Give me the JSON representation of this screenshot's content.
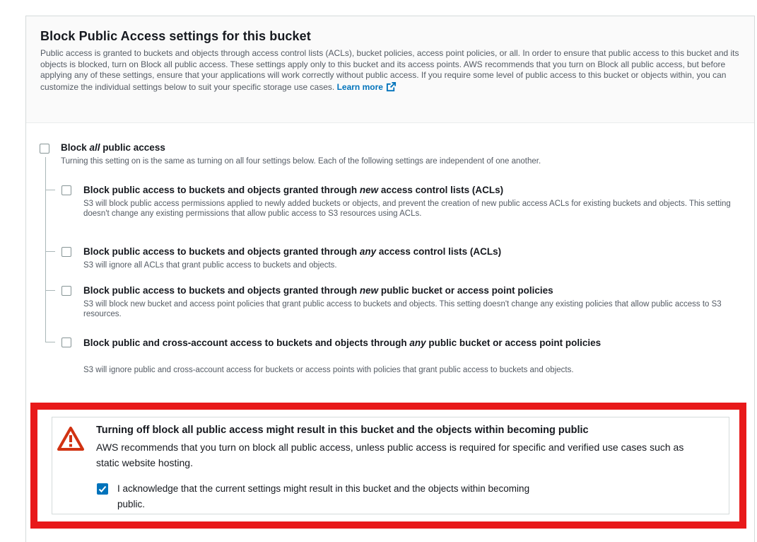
{
  "header": {
    "title": "Block Public Access settings for this bucket",
    "description": "Public access is granted to buckets and objects through access control lists (ACLs), bucket policies, access point policies, or all. In order to ensure that public access to this bucket and its objects is blocked, turn on Block all public access. These settings apply only to this bucket and its access points. AWS recommends that you turn on Block all public access, but before applying any of these settings, ensure that your applications will work correctly without public access. If you require some level of public access to this bucket or objects within, you can customize the individual settings below to suit your specific storage use cases.",
    "learn_more": "Learn more"
  },
  "block_all": {
    "title_prefix": "Block ",
    "title_em": "all",
    "title_suffix": " public access",
    "description": "Turning this setting on is the same as turning on all four settings below. Each of the following settings are independent of one another.",
    "checked": false
  },
  "settings": [
    {
      "title_prefix": "Block public access to buckets and objects granted through ",
      "title_em": "new",
      "title_suffix": " access control lists (ACLs)",
      "description": "S3 will block public access permissions applied to newly added buckets or objects, and prevent the creation of new public access ACLs for existing buckets and objects. This setting doesn't change any existing permissions that allow public access to S3 resources using ACLs.",
      "checked": false
    },
    {
      "title_prefix": "Block public access to buckets and objects granted through ",
      "title_em": "any",
      "title_suffix": " access control lists (ACLs)",
      "description": "S3 will ignore all ACLs that grant public access to buckets and objects.",
      "checked": false
    },
    {
      "title_prefix": "Block public access to buckets and objects granted through ",
      "title_em": "new",
      "title_suffix": " public bucket or access point policies",
      "description": "S3 will block new bucket and access point policies that grant public access to buckets and objects. This setting doesn't change any existing policies that allow public access to S3 resources.",
      "checked": false
    },
    {
      "title_prefix": "Block public and cross-account access to buckets and objects through ",
      "title_em": "any",
      "title_suffix": " public bucket or access point policies",
      "description": "S3 will ignore public and cross-account access for buckets or access points with policies that grant public access to buckets and objects.",
      "checked": false
    }
  ],
  "warning": {
    "title": "Turning off block all public access might result in this bucket and the objects within becoming public",
    "body": "AWS recommends that you turn on block all public access, unless public access is required for specific and verified use cases such as static website hosting.",
    "acknowledge_label": "I acknowledge that the current settings might result in this bucket and the objects within becoming public.",
    "acknowledged": true
  },
  "colors": {
    "accent": "#0073bb",
    "warning_icon": "#d13212",
    "highlight_border": "#e8191a"
  },
  "icons": {
    "external_link": "external-link-icon",
    "warning": "warning-icon",
    "checkmark": "checkmark-icon"
  }
}
